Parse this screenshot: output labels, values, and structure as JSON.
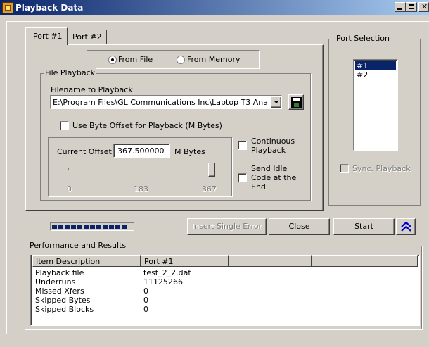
{
  "window": {
    "title": "Playback Data"
  },
  "tabs": [
    {
      "label": "Port #1"
    },
    {
      "label": "Port #2"
    }
  ],
  "source": {
    "from_file": "From File",
    "from_memory": "From Memory",
    "selected": "from_file"
  },
  "file_playback": {
    "group_label": "File Playback",
    "filename_label": "Filename to Playback",
    "filename_value": "E:\\Program Files\\GL Communications Inc\\Laptop T3 Anal",
    "use_byte_offset_label": "Use Byte Offset for Playback (M Bytes)",
    "current_offset_label": "Current Offset",
    "current_offset_value": "367.500000",
    "offset_unit": "M Bytes",
    "slider_ticks": [
      "0",
      "183",
      "367"
    ],
    "slider_level_percent": 100,
    "continuous_label": "Continuous Playback",
    "send_idle_label": "Send Idle Code at the End"
  },
  "port_selection": {
    "group_label": "Port Selection",
    "items": [
      "#1",
      "#2"
    ],
    "selected": "#1",
    "sync_label": "Sync. Playback"
  },
  "buttons": {
    "insert_error": "Insert Single Error",
    "close": "Close",
    "start": "Start"
  },
  "progress": {
    "segments_filled": 12,
    "segments_total": 16
  },
  "performance": {
    "group_label": "Performance and Results",
    "columns": [
      "Item Description",
      "Port #1",
      "",
      ""
    ],
    "rows": [
      {
        "item": "Playback file",
        "port1": "test_2_2.dat"
      },
      {
        "item": "Underruns",
        "port1": "11125266"
      },
      {
        "item": "Missed Xfers",
        "port1": "0"
      },
      {
        "item": "Skipped Bytes",
        "port1": "0"
      },
      {
        "item": "Skipped Blocks",
        "port1": "0"
      }
    ]
  },
  "colors": {
    "title_start": "#0a246a",
    "title_end": "#a6caf0",
    "selection": "#0a246a",
    "accent_blue": "#0000cc"
  }
}
